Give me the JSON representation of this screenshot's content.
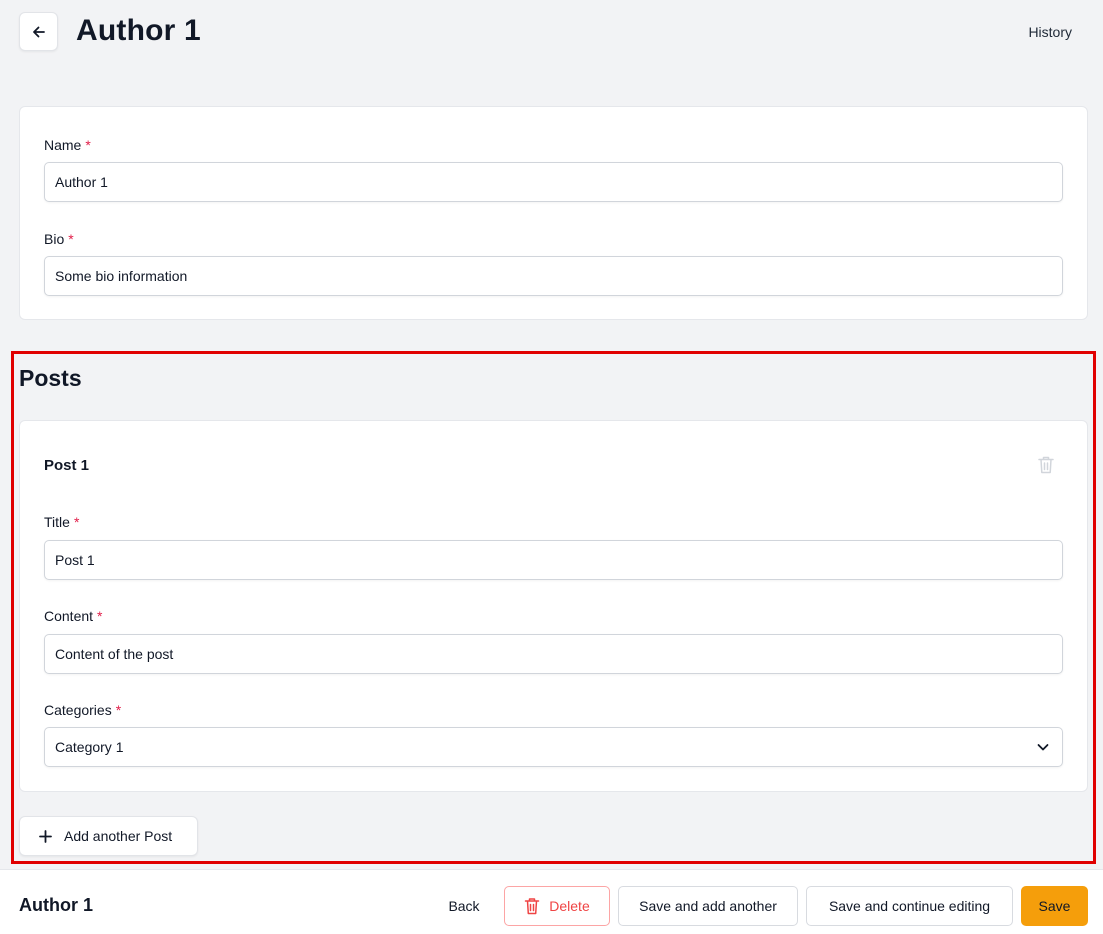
{
  "header": {
    "title": "Author 1",
    "history_label": "History"
  },
  "author_form": {
    "name": {
      "label": "Name",
      "required_mark": "*",
      "value": "Author 1"
    },
    "bio": {
      "label": "Bio",
      "required_mark": "*",
      "value": "Some bio information"
    }
  },
  "posts": {
    "section_title": "Posts",
    "items": [
      {
        "title": "Post 1",
        "fields": {
          "title": {
            "label": "Title",
            "required_mark": "*",
            "value": "Post 1"
          },
          "content": {
            "label": "Content",
            "required_mark": "*",
            "value": "Content of the post"
          },
          "categories": {
            "label": "Categories",
            "required_mark": "*",
            "value": "Category 1"
          }
        }
      }
    ],
    "add_label": "Add another Post"
  },
  "footer": {
    "title": "Author 1",
    "back_label": "Back",
    "delete_label": "Delete",
    "save_add_label": "Save and add another",
    "save_continue_label": "Save and continue editing",
    "save_label": "Save"
  },
  "colors": {
    "primary": "#f59e0b",
    "danger": "#ef4444",
    "required": "#e11d48",
    "highlight": "#e00000"
  },
  "icons": {
    "back": "arrow-left-icon",
    "delete": "trash-icon",
    "add": "plus-icon",
    "select": "chevron-down-icon"
  }
}
